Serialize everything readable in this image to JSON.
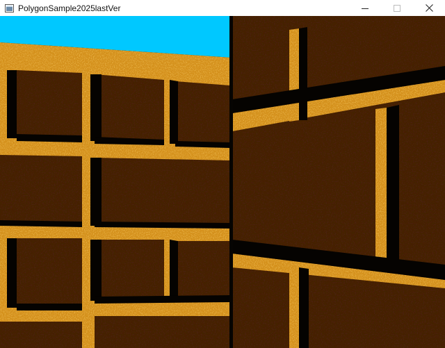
{
  "window": {
    "title": "PolygonSample2025lastVer",
    "app_icon": "window-app-icon",
    "controls": [
      "minimize-icon",
      "maximize-icon",
      "close-icon"
    ]
  },
  "scene": {
    "sky_color": "#00c8ff",
    "mortar_color": "#d4901c",
    "brick_color": "#4a2408",
    "shadow_color": "#050301"
  }
}
